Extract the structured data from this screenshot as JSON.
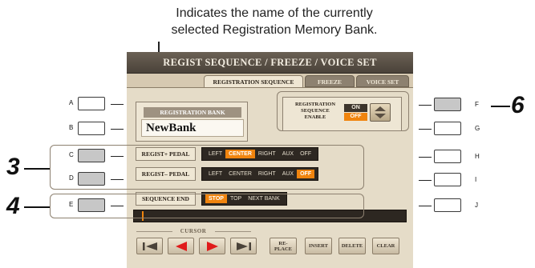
{
  "caption": {
    "line1": "Indicates the name of the currently",
    "line2": "selected Registration Memory Bank."
  },
  "screen": {
    "title": "REGIST SEQUENCE / FREEZE / VOICE SET",
    "tabs": [
      {
        "label": "REGISTRATION SEQUENCE",
        "active": true
      },
      {
        "label": "FREEZE",
        "active": false
      },
      {
        "label": "VOICE SET",
        "active": false
      }
    ],
    "registration_bank": {
      "label": "REGISTRATION BANK",
      "name": "NewBank"
    },
    "sequence_enable": {
      "label_lines": [
        "REGISTRATION",
        "SEQUENCE",
        "ENABLE"
      ],
      "on_label": "ON",
      "off_label": "OFF",
      "selected": "OFF"
    },
    "regist_plus_pedal": {
      "label": "REGIST+ PEDAL",
      "options": [
        "LEFT",
        "CENTER",
        "RIGHT",
        "AUX",
        "OFF"
      ],
      "selected": "CENTER"
    },
    "regist_minus_pedal": {
      "label": "REGIST– PEDAL",
      "options": [
        "LEFT",
        "CENTER",
        "RIGHT",
        "AUX",
        "OFF"
      ],
      "selected": "OFF"
    },
    "sequence_end": {
      "label": "SEQUENCE END",
      "options": [
        "STOP",
        "TOP",
        "NEXT BANK"
      ],
      "selected": "STOP"
    },
    "cursor_label": "CURSOR",
    "buttons": {
      "replace_line1": "RE-",
      "replace_line2": "PLACE",
      "insert": "INSERT",
      "delete": "DELETE",
      "clear": "CLEAR"
    }
  },
  "side_keys": {
    "left": [
      "A",
      "B",
      "C",
      "D",
      "E"
    ],
    "right": [
      "F",
      "G",
      "H",
      "I",
      "J"
    ]
  },
  "callouts": [
    "3",
    "4",
    "6"
  ],
  "colors": {
    "accent_orange": "#f0840e",
    "title_bar": "#4a4239",
    "panel": "#e5dcc8"
  }
}
